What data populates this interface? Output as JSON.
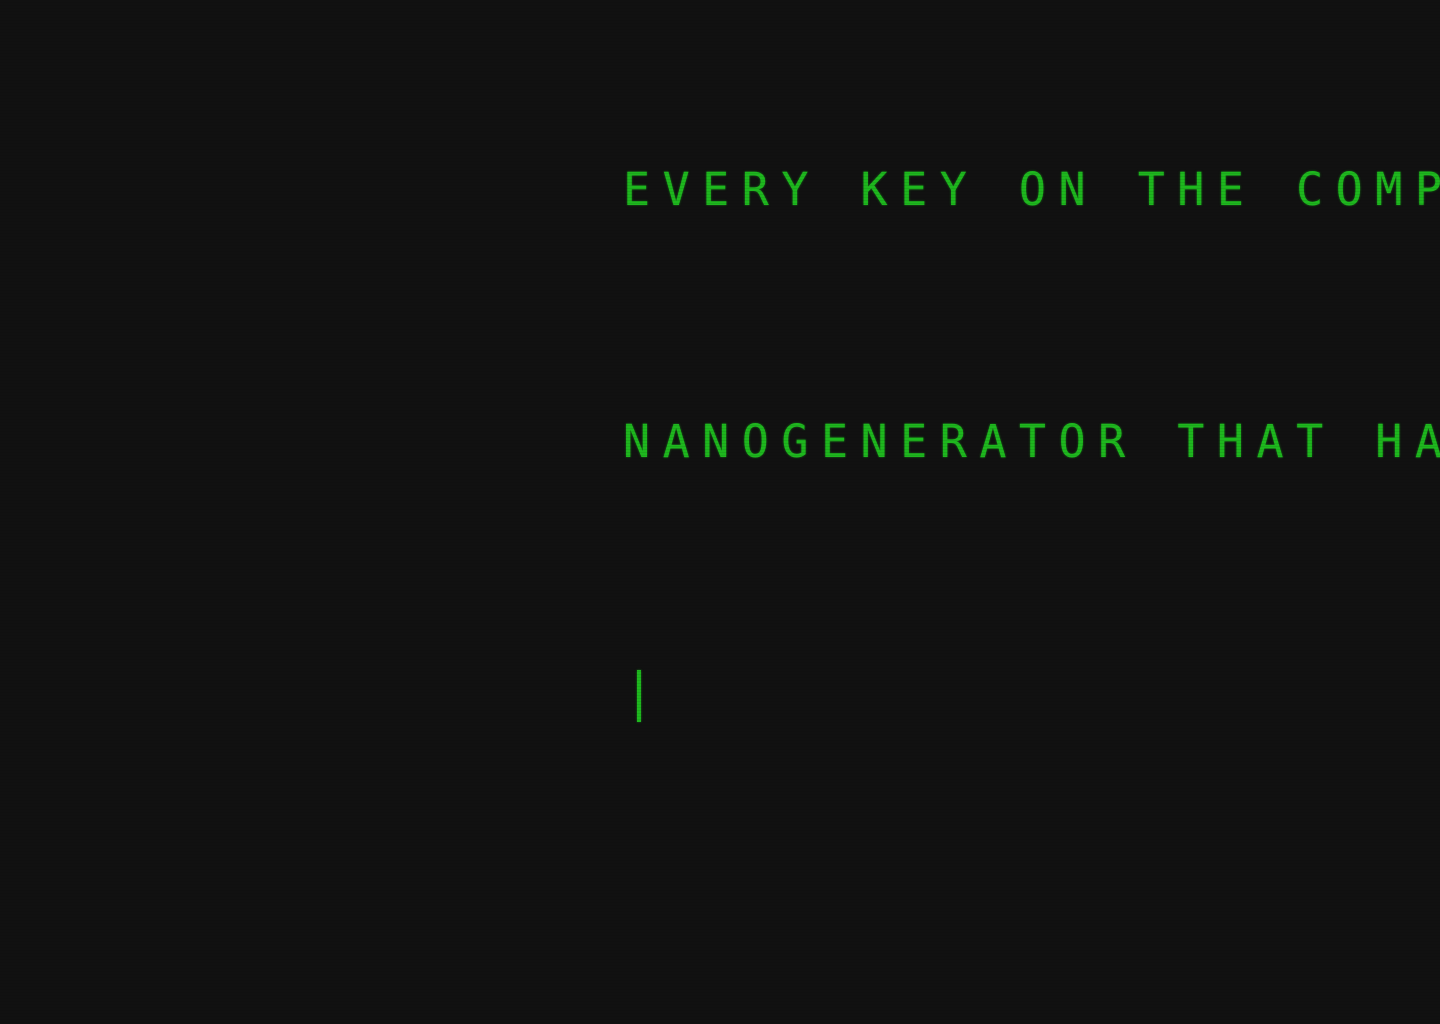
{
  "terminal": {
    "lines": [
      "EVERY KEY ON THE COMP",
      "NANOGENERATOR THAT HA"
    ]
  },
  "colors": {
    "background": "#111111",
    "text": "#1eb81e"
  }
}
